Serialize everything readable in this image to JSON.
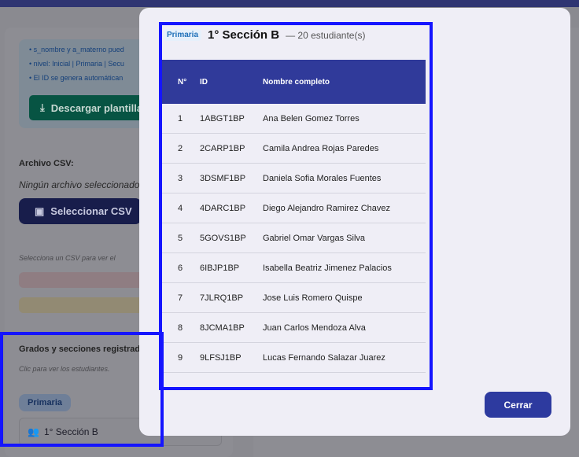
{
  "left_panel": {
    "hints": [
      "• s_nombre y a_materno pued",
      "• nivel: Inicial | Primaria | Secu",
      "• El ID se genera automátican"
    ],
    "download_label": "Descargar plantilla",
    "csv_label": "Archivo CSV:",
    "no_file": "Ningún archivo seleccionado",
    "select_label": "Seleccionar CSV",
    "preview_hint": "Selecciona un CSV para ver el",
    "grades_title": "Grados y secciones registrad",
    "grades_hint": "Clic para ver los estudiantes.",
    "level_badge": "Primaria",
    "section_label": "1° Sección B"
  },
  "modal": {
    "badge": "Primaria",
    "title": "1° Sección B",
    "count": "— 20 estudiante(s)",
    "columns": [
      "N°",
      "ID",
      "Nombre completo"
    ],
    "rows": [
      {
        "n": "1",
        "id": "1ABGT1BP",
        "name": "Ana Belen Gomez Torres"
      },
      {
        "n": "2",
        "id": "2CARP1BP",
        "name": "Camila Andrea Rojas Paredes"
      },
      {
        "n": "3",
        "id": "3DSMF1BP",
        "name": "Daniela Sofia Morales Fuentes"
      },
      {
        "n": "4",
        "id": "4DARC1BP",
        "name": "Diego Alejandro Ramirez Chavez"
      },
      {
        "n": "5",
        "id": "5GOVS1BP",
        "name": "Gabriel Omar Vargas Silva"
      },
      {
        "n": "6",
        "id": "6IBJP1BP",
        "name": "Isabella Beatriz Jimenez Palacios"
      },
      {
        "n": "7",
        "id": "7JLRQ1BP",
        "name": "Jose Luis Romero Quispe"
      },
      {
        "n": "8",
        "id": "8JCMA1BP",
        "name": "Juan Carlos Mendoza Alva"
      },
      {
        "n": "9",
        "id": "9LFSJ1BP",
        "name": "Lucas Fernando Salazar Juarez"
      }
    ],
    "close_label": "Cerrar"
  },
  "colors": {
    "accent": "#303a9a",
    "highlight": "#1515ff"
  }
}
